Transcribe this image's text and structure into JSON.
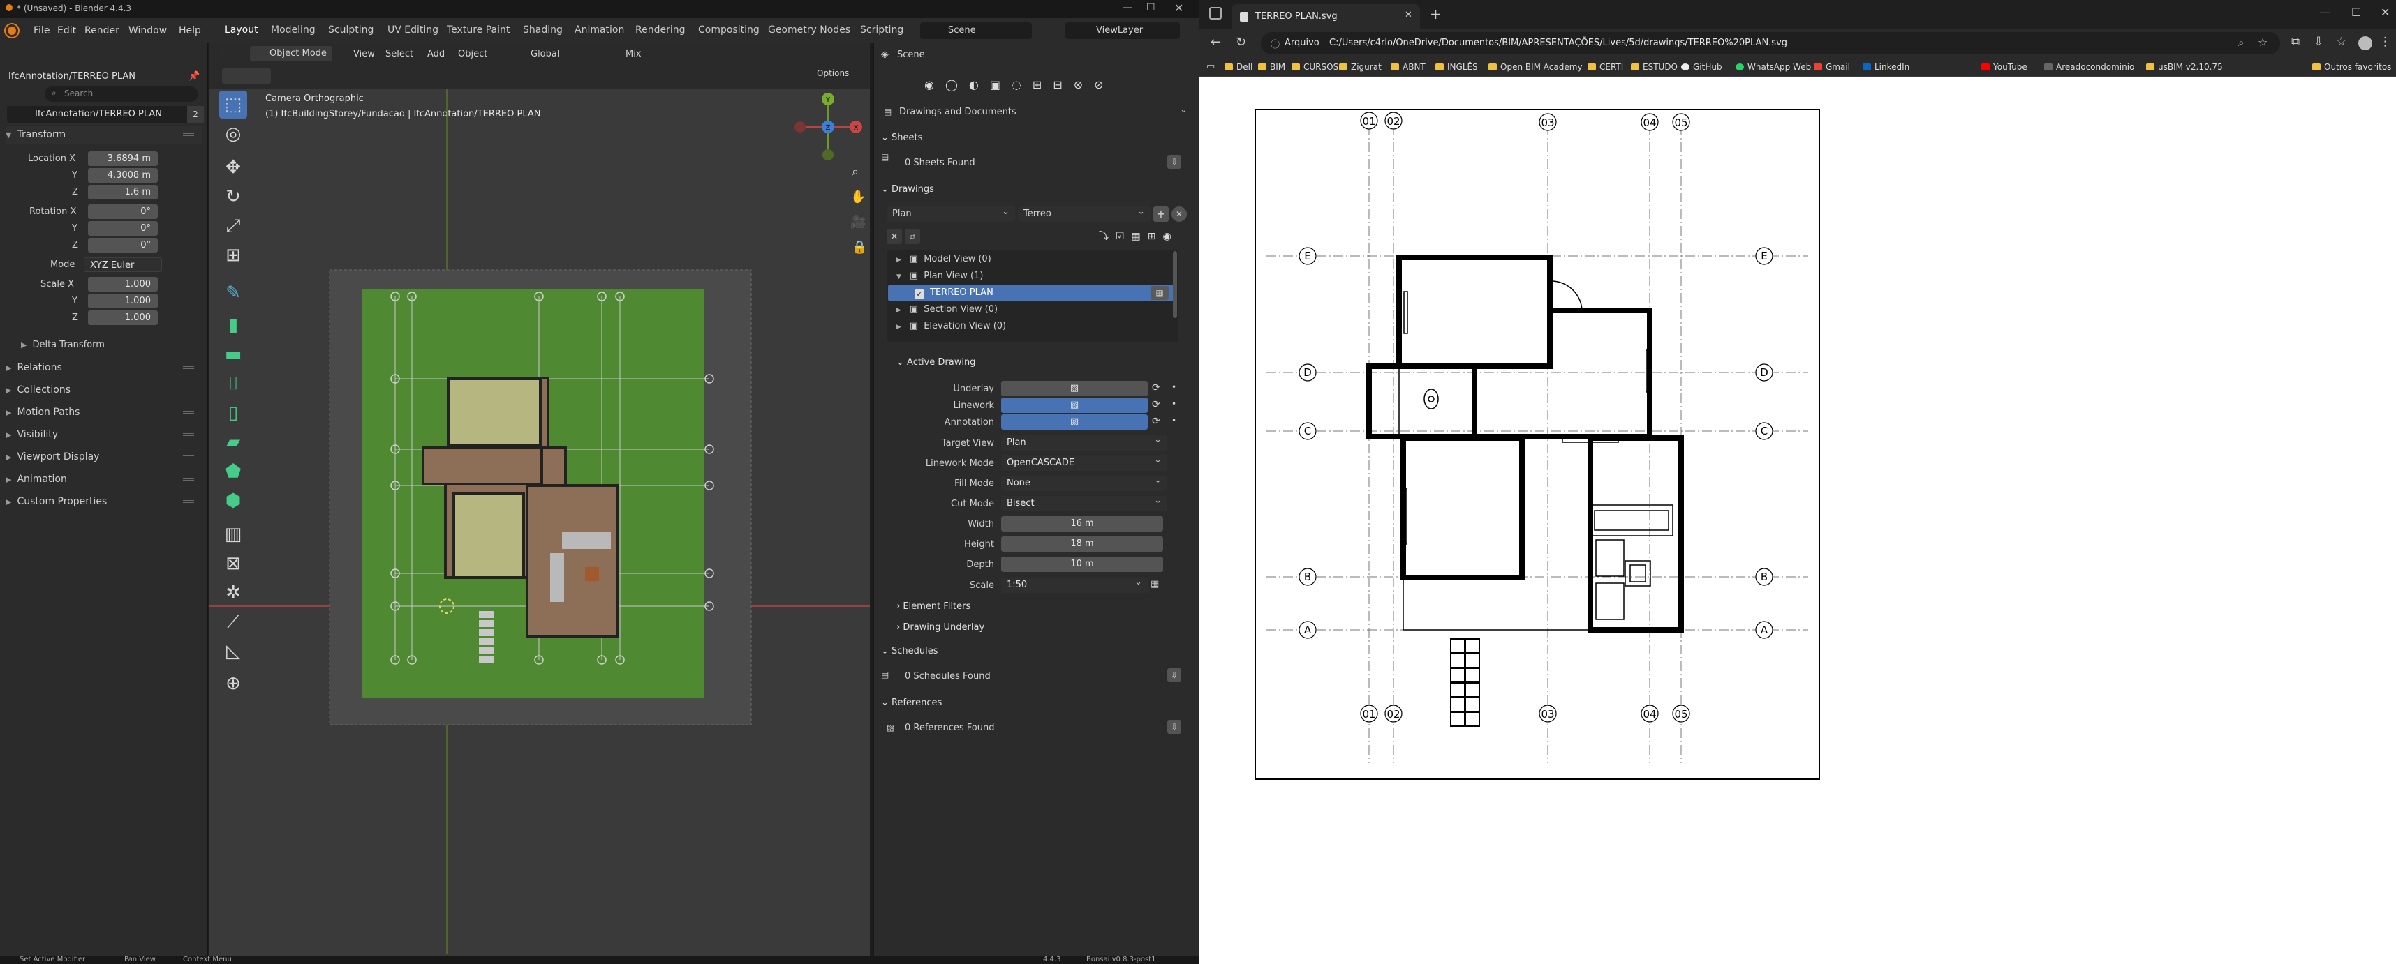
{
  "blender": {
    "title": "* (Unsaved) - Blender 4.4.3",
    "menus": [
      "File",
      "Edit",
      "Render",
      "Window",
      "Help"
    ],
    "workspaces": [
      "Layout",
      "Modeling",
      "Sculpting",
      "UV Editing",
      "Texture Paint",
      "Shading",
      "Animation",
      "Rendering",
      "Compositing",
      "Geometry Nodes",
      "Scripting"
    ],
    "active_workspace": "Layout",
    "scene": "Scene",
    "view_layer": "ViewLayer",
    "props_header": "IfcAnnotation/TERREO PLAN",
    "search_placeholder": "Search",
    "object_name": "IfcAnnotation/TERREO PLAN",
    "object_users": "2",
    "transform": {
      "title": "Transform",
      "location_x_label": "Location X",
      "location_x": "3.6894 m",
      "y_label": "Y",
      "location_y": "4.3008 m",
      "z_label": "Z",
      "location_z": "1.6 m",
      "rotation_x_label": "Rotation X",
      "rotation_x": "0°",
      "rotation_y": "0°",
      "rotation_z": "0°",
      "mode_label": "Mode",
      "mode": "XYZ Euler",
      "scale_x_label": "Scale X",
      "scale_x": "1.000",
      "scale_y": "1.000",
      "scale_z": "1.000",
      "delta": "Delta Transform"
    },
    "sections": [
      "Relations",
      "Collections",
      "Motion Paths",
      "Visibility",
      "Viewport Display",
      "Animation",
      "Custom Properties"
    ],
    "viewport": {
      "mode": "Object Mode",
      "menus": [
        "View",
        "Select",
        "Add",
        "Object"
      ],
      "orientation": "Global",
      "mix": "Mix",
      "options": "Options",
      "camera": "Camera Orthographic",
      "path": "(1) IfcBuildingStorey/Fundacao | IfcAnnotation/TERREO PLAN",
      "gizmo_x": "X",
      "gizmo_y": "Y",
      "gizmo_z": "Z"
    },
    "panel": {
      "header": "Scene",
      "dropdown": "Drawings and Documents",
      "sheets_title": "Sheets",
      "sheets_found": "0 Sheets Found",
      "drawings_title": "Drawings",
      "drawing_type": "Plan",
      "drawing_storey": "Terreo",
      "tree": [
        {
          "label": "Model View (0)",
          "indent": 0
        },
        {
          "label": "Plan View (1)",
          "indent": 0
        },
        {
          "label": "TERREO PLAN",
          "indent": 1
        },
        {
          "label": "Section View (0)",
          "indent": 0
        },
        {
          "label": "Elevation View (0)",
          "indent": 0
        }
      ],
      "active_drawing_title": "Active Drawing",
      "underlay_label": "Underlay",
      "linework_label": "Linework",
      "annotation_label": "Annotation",
      "target_view_label": "Target View",
      "target_view": "Plan",
      "linework_mode_label": "Linework Mode",
      "linework_mode": "OpenCASCADE",
      "fill_mode_label": "Fill Mode",
      "fill_mode": "None",
      "cut_mode_label": "Cut Mode",
      "cut_mode": "Bisect",
      "width_label": "Width",
      "width": "16 m",
      "height_label": "Height",
      "height": "18 m",
      "depth_label": "Depth",
      "depth": "10 m",
      "scale_label": "Scale",
      "scale": "1:50",
      "element_filters": "Element Filters",
      "drawing_underlay": "Drawing Underlay",
      "schedules_title": "Schedules",
      "schedules_found": "0 Schedules Found",
      "references_title": "References",
      "references_found": "0 References Found"
    },
    "status": {
      "left1": "Set Active Modifier",
      "left2": "Pan View",
      "left3": "Context Menu",
      "version": "4.4.3",
      "bonsai": "Bonsai v0.8.3-post1"
    }
  },
  "browser": {
    "tab_title": "TERREO PLAN.svg",
    "address_prefix": "Arquivo",
    "address": "C:/Users/c4rlo/OneDrive/Documentos/BIM/APRESENTAÇÕES/Lives/5d/drawings/TERREO%20PLAN.svg",
    "bookmarks": [
      "Dell",
      "BIM",
      "CURSOS",
      "Zigurat",
      "ABNT",
      "INGLÊS",
      "Open BIM Academy",
      "CERTI",
      "ESTUDO",
      "GitHub",
      "WhatsApp Web",
      "Gmail",
      "LinkedIn",
      "YouTube",
      "Areadocondominio",
      "usBIM v2.10.75"
    ],
    "other_bookmarks": "Outros favoritos"
  },
  "drawing": {
    "grid_top": [
      "01",
      "02",
      "03",
      "04",
      "05"
    ],
    "grid_side": [
      "E",
      "D",
      "C",
      "B",
      "A"
    ]
  }
}
